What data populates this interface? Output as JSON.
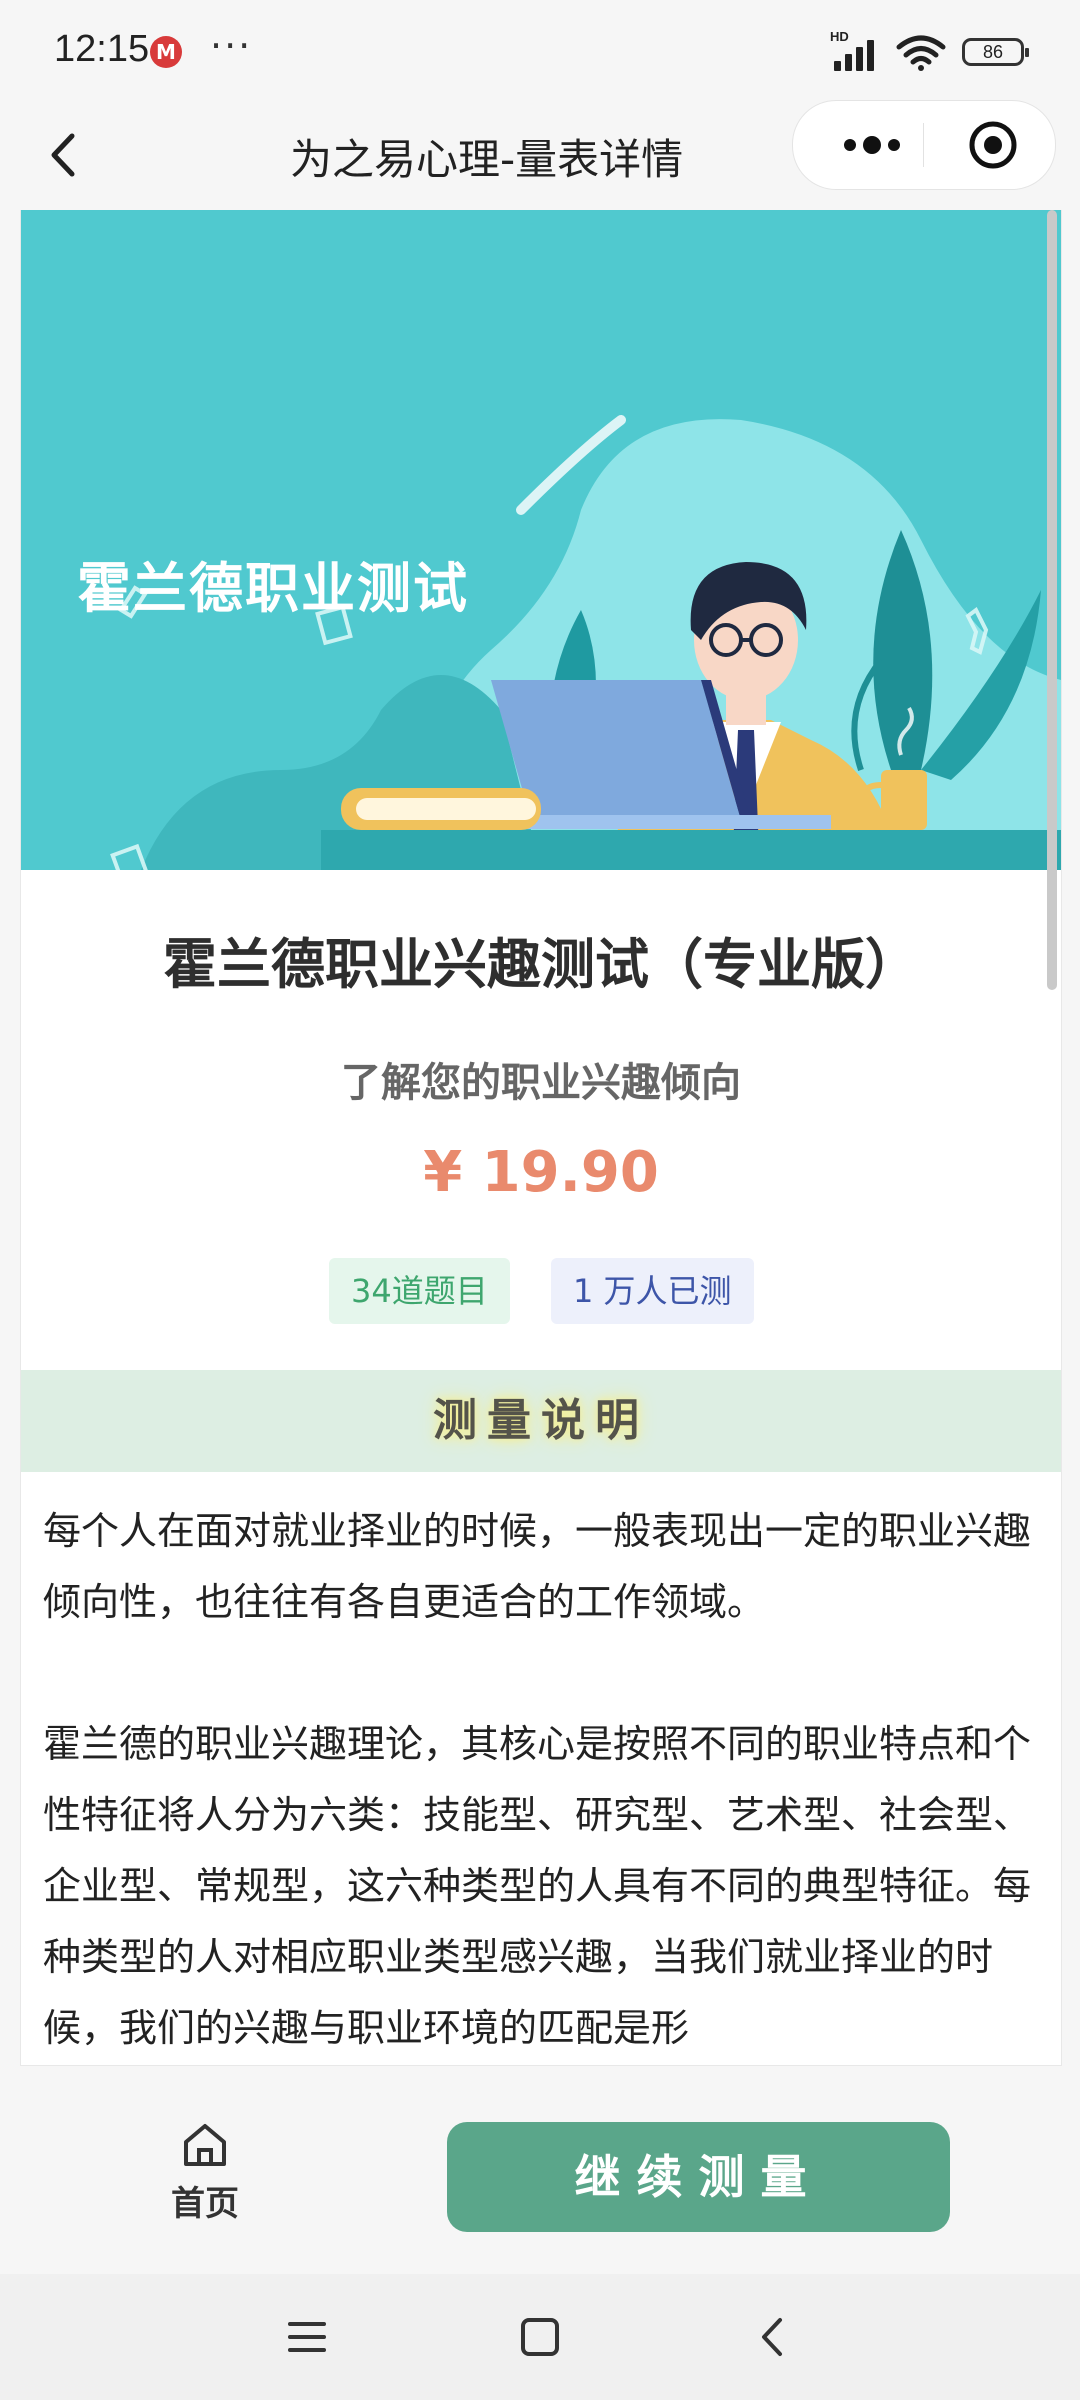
{
  "status_bar": {
    "time": "12:15",
    "app_icon": "M",
    "more": "···",
    "network": "HD",
    "battery": "86"
  },
  "header": {
    "title": "为之易心理-量表详情"
  },
  "banner": {
    "text": "霍兰德职业测试"
  },
  "product": {
    "title": "霍兰德职业兴趣测试（专业版）",
    "subtitle": "了解您的职业兴趣倾向",
    "price": "¥ 19.90",
    "tags": [
      "34道题目",
      "1 万人已测"
    ]
  },
  "section": {
    "title": "测量说明"
  },
  "description": [
    "每个人在面对就业择业的时候，一般表现出一定的职业兴趣倾向性，也往往有各自更适合的工作领域。",
    "霍兰德的职业兴趣理论，其核心是按照不同的职业特点和个性特征将人分为六类：技能型、研究型、艺术型、社会型、企业型、常规型，这六种类型的人具有不同的典型特征。每种类型的人对相应职业类型感兴趣，当我们就业择业的时候，我们的兴趣与职业环境的匹配是形"
  ],
  "bottom": {
    "home_label": "首页",
    "continue_label": "继续测量"
  },
  "colors": {
    "accent": "#5aa68a",
    "price": "#e98a6d",
    "banner": "#50c9cf",
    "section_bg": "#ddeee3"
  }
}
